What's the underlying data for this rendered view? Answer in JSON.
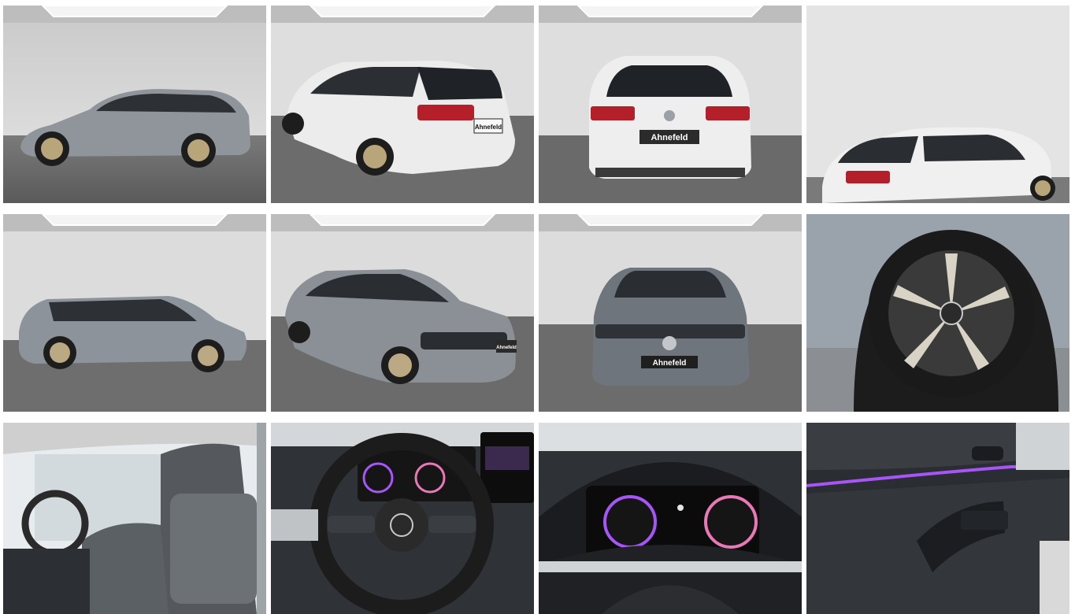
{
  "gallery": {
    "photos": [
      {
        "name": "exterior-side-left",
        "view": "side profile left, studio"
      },
      {
        "name": "exterior-rear-three-quarter",
        "view": "rear three-quarter left"
      },
      {
        "name": "exterior-rear",
        "view": "rear"
      },
      {
        "name": "exterior-rear-three-quarter-right",
        "view": "rear three-quarter right"
      },
      {
        "name": "exterior-side-right",
        "view": "side profile right, studio"
      },
      {
        "name": "exterior-front-three-quarter",
        "view": "front three-quarter right"
      },
      {
        "name": "exterior-front",
        "view": "front"
      },
      {
        "name": "wheel-closeup",
        "view": "alloy wheel detail"
      },
      {
        "name": "interior-front-seats",
        "view": "front seats"
      },
      {
        "name": "interior-steering-wheel",
        "view": "steering wheel and cockpit"
      },
      {
        "name": "interior-instrument-cluster",
        "view": "digital instrument cluster"
      },
      {
        "name": "interior-door-panel",
        "view": "door panel with ambient lighting"
      }
    ],
    "plate_text": "Ahnefeld",
    "colors": {
      "studio_wall": "#d9d9d9",
      "studio_floor": "#6f6f6f",
      "car_grey": "#8f959b",
      "car_white": "#eeeeee",
      "tail_light": "#b3202a",
      "ambient_purple": "#a855f7"
    }
  }
}
